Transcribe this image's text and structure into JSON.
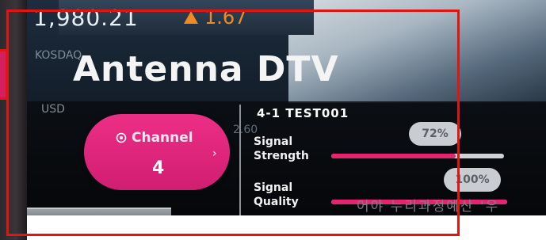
{
  "background": {
    "ticker_value": "1,980.21",
    "ticker_change": "1.67",
    "kosdaq": "KOSDAQ",
    "usd": "USD",
    "side_value": "2.60",
    "korean_text": "어야 누리과정예산 '우"
  },
  "overlay": {
    "title": "Antenna DTV",
    "channel": {
      "label": "Channel",
      "number": "4"
    },
    "program": "4-1 TEST001",
    "signal_strength": {
      "label_line1": "Signal",
      "label_line2": "Strength",
      "value_text": "72%",
      "value": 72
    },
    "signal_quality": {
      "label_line1": "Signal",
      "label_line2": "Quality",
      "value_text": "100%",
      "value": 100
    }
  },
  "colors": {
    "accent": "#e5246f",
    "channel_button": "#e12a7c",
    "annotation": "#e11414",
    "ticker_up": "#f08a24"
  },
  "icons": {
    "channel": "tv-antenna-icon",
    "chevron": "chevron-right-icon",
    "ticker_arrow": "up-triangle-icon"
  }
}
